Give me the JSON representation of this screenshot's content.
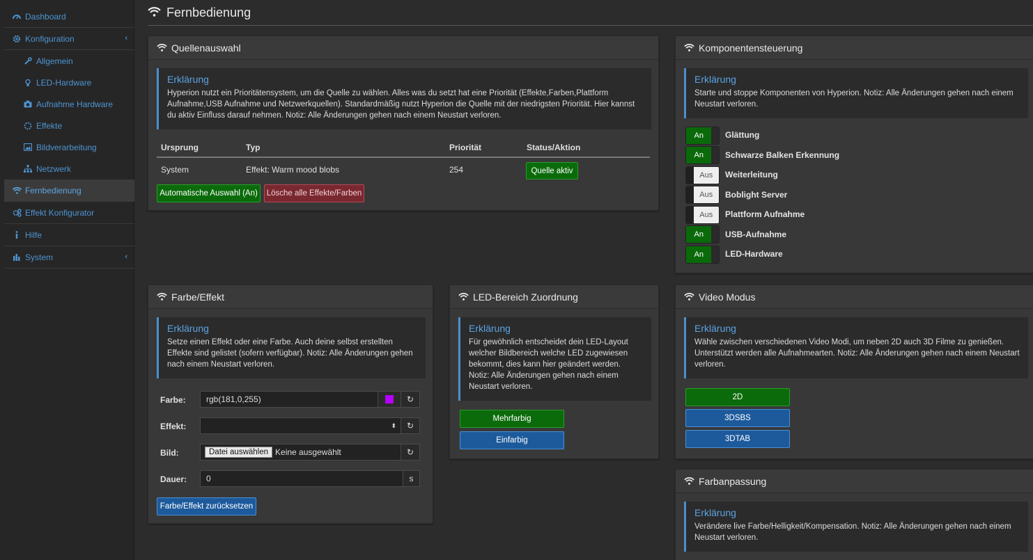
{
  "sidebar": {
    "items": [
      {
        "label": "Dashboard",
        "icon": "dashboard-icon"
      },
      {
        "label": "Konfiguration",
        "icon": "gear-icon"
      },
      {
        "label": "Allgemein",
        "icon": "wrench-icon"
      },
      {
        "label": "LED-Hardware",
        "icon": "lightbulb-icon"
      },
      {
        "label": "Aufnahme Hardware",
        "icon": "camera-icon"
      },
      {
        "label": "Effekte",
        "icon": "spinner-icon"
      },
      {
        "label": "Bildverarbeitung",
        "icon": "image-icon"
      },
      {
        "label": "Netzwerk",
        "icon": "sitemap-icon"
      },
      {
        "label": "Fernbedienung",
        "icon": "wifi-icon"
      },
      {
        "label": "Effekt Konfigurator",
        "icon": "gears-icon"
      },
      {
        "label": "Hilfe",
        "icon": "info-icon"
      },
      {
        "label": "System",
        "icon": "bar-chart-icon"
      }
    ]
  },
  "header": {
    "title": "Fernbedienung"
  },
  "quellen": {
    "title": "Quellenauswahl",
    "callout_title": "Erklärung",
    "callout_text": "Hyperion nutzt ein Prioritätensystem, um die Quelle zu wählen. Alles was du setzt hat eine Priorität (Effekte,Farben,Plattform Aufnahme,USB Aufnahme und Netzwerkquellen). Standardmäßig nutzt Hyperion die Quelle mit der niedrigsten Priorität. Hier kannst du aktiv Einfluss darauf nehmen. Notiz: Alle Änderungen gehen nach einem Neustart verloren.",
    "columns": [
      "Ursprung",
      "Typ",
      "Priorität",
      "Status/Aktion"
    ],
    "row": {
      "origin": "System",
      "type": "Effekt: Warm mood blobs",
      "priority": "254",
      "action": "Quelle aktiv"
    },
    "auto_button": "Automatische Auswahl (An)",
    "clear_button": "Lösche alle Effekte/Farben"
  },
  "komponenten": {
    "title": "Komponentensteuerung",
    "callout_title": "Erklärung",
    "callout_text": "Starte und stoppe Komponenten von Hyperion. Notiz: Alle Änderungen gehen nach einem Neustart verloren.",
    "items": [
      {
        "label": "Glättung",
        "state": "An"
      },
      {
        "label": "Schwarze Balken Erkennung",
        "state": "An"
      },
      {
        "label": "Weiterleitung",
        "state": "Aus"
      },
      {
        "label": "Boblight Server",
        "state": "Aus"
      },
      {
        "label": "Plattform Aufnahme",
        "state": "Aus"
      },
      {
        "label": "USB-Aufnahme",
        "state": "An"
      },
      {
        "label": "LED-Hardware",
        "state": "An"
      }
    ]
  },
  "farbe": {
    "title": "Farbe/Effekt",
    "callout_title": "Erklärung",
    "callout_text": "Setze einen Effekt oder eine Farbe. Auch deine selbst erstellten Effekte sind gelistet (sofern verfügbar). Notiz: Alle Änderungen gehen nach einem Neustart verloren.",
    "color_label": "Farbe:",
    "color_value": "rgb(181,0,255)",
    "swatch": "#b500ff",
    "effect_label": "Effekt:",
    "effect_value": "",
    "image_label": "Bild:",
    "file_button": "Datei auswählen",
    "file_none": "Keine ausgewählt",
    "duration_label": "Dauer:",
    "duration_value": "0",
    "duration_unit": "s",
    "reset_button": "Farbe/Effekt zurücksetzen"
  },
  "led": {
    "title": "LED-Bereich Zuordnung",
    "callout_title": "Erklärung",
    "callout_text": "Für gewöhnlich entscheidet dein LED-Layout welcher Bildbereich welche LED zugewiesen bekommt, dies kann hier geändert werden. Notiz: Alle Änderungen gehen nach einem Neustart verloren.",
    "multi_button": "Mehrfarbig",
    "single_button": "Einfarbig"
  },
  "video": {
    "title": "Video Modus",
    "callout_title": "Erklärung",
    "callout_text": "Wähle zwischen verschiedenen Video Modi, um neben 2D auch 3D Filme zu genießen. Unterstützt werden alle Aufnahmearten. Notiz: Alle Änderungen gehen nach einem Neustart verloren.",
    "modes": [
      "2D",
      "3DSBS",
      "3DTAB"
    ]
  },
  "farbanpassung": {
    "title": "Farbanpassung",
    "callout_title": "Erklärung",
    "callout_text": "Verändere live Farbe/Helligkeit/Kompensation. Notiz: Alle Änderungen gehen nach einem Neustart verloren."
  },
  "colors": {
    "accent": "#4d94d1",
    "green": "#0b6b0b",
    "red": "#7a2830",
    "blue": "#1d5a9c"
  }
}
